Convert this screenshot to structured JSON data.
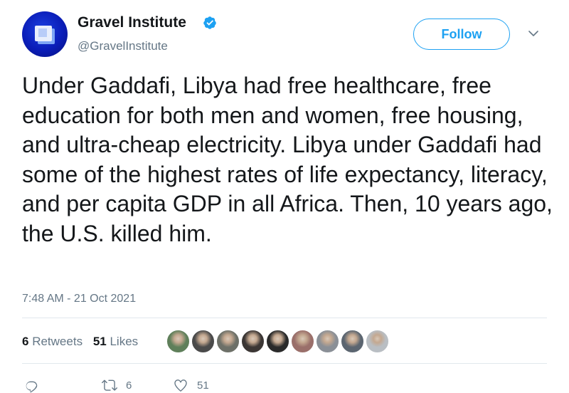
{
  "author": {
    "display_name": "Gravel Institute",
    "handle": "@GravelInstitute",
    "verified_icon": "verified-badge-icon",
    "avatar_colors": {
      "bg": "#0a1db8",
      "cube": "#e8eefc",
      "accent": "#7ea6f5"
    }
  },
  "actions": {
    "follow_label": "Follow",
    "menu_icon": "chevron-down-icon"
  },
  "tweet": {
    "text": "Under Gaddafi, Libya had free healthcare, free education for both men and women, free housing, and ultra-cheap electricity. Libya under Gaddafi had some of the highest rates of life expectancy, literacy, and per capita GDP in all Africa. Then, 10 years ago, the U.S. killed him.",
    "timestamp": "7:48 AM - 21 Oct 2021"
  },
  "stats": {
    "retweets_count": "6",
    "retweets_label": "Retweets",
    "likes_count": "51",
    "likes_label": "Likes"
  },
  "likers": [
    {
      "color": "#5f7f5a"
    },
    {
      "color": "#4a4a4a"
    },
    {
      "color": "#6d7068"
    },
    {
      "color": "#3b3634"
    },
    {
      "color": "#2a2a2a"
    },
    {
      "color": "#9a6f6a"
    },
    {
      "color": "#8a8f96"
    },
    {
      "color": "#5b6570"
    },
    {
      "color": "#b9bec3"
    }
  ],
  "action_bar": {
    "reply_icon": "reply-icon",
    "retweet_icon": "retweet-icon",
    "retweet_count": "6",
    "like_icon": "heart-icon",
    "like_count": "51"
  },
  "colors": {
    "accent": "#1da1f2",
    "text": "#14171a",
    "muted": "#657786",
    "divider": "#e1e8ed"
  }
}
